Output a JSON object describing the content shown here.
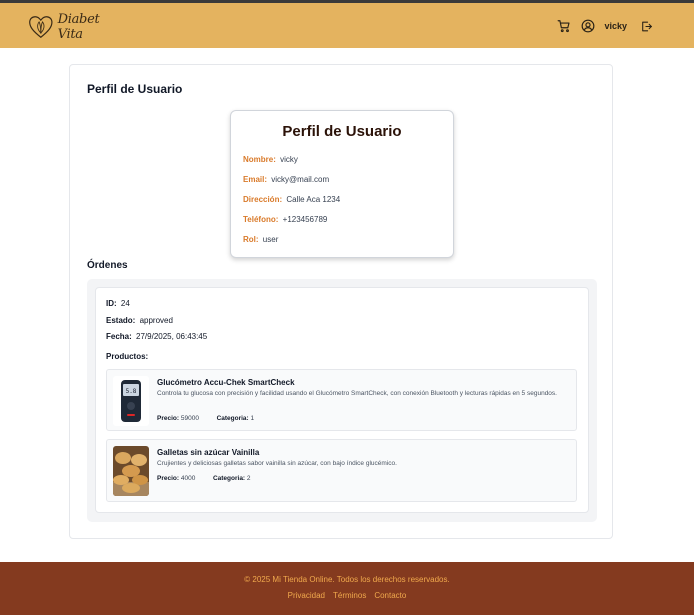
{
  "brand": {
    "logo_text": "Diabet Vita"
  },
  "header": {
    "username": "vicky",
    "icons": [
      "cart-icon",
      "user-circle-icon",
      "logout-icon"
    ]
  },
  "page": {
    "title": "Perfil de Usuario"
  },
  "profile": {
    "heading": "Perfil de Usuario",
    "fields": [
      {
        "label": "Nombre:",
        "value": "vicky"
      },
      {
        "label": "Email:",
        "value": "vicky@mail.com"
      },
      {
        "label": "Dirección:",
        "value": "Calle Aca 1234"
      },
      {
        "label": "Teléfono:",
        "value": "+123456789"
      },
      {
        "label": "Rol:",
        "value": "user"
      }
    ]
  },
  "orders": {
    "title": "Órdenes",
    "items": [
      {
        "id_label": "ID:",
        "id": "24",
        "status_label": "Estado:",
        "status": "approved",
        "date_label": "Fecha:",
        "date": "27/9/2025, 06:43:45",
        "products_label": "Productos:",
        "products": [
          {
            "name": "Glucómetro Accu-Chek SmartCheck",
            "description": "Controla tu glucosa con precisión y facilidad usando el Glucómetro SmartCheck, con conexión Bluetooth y lecturas rápidas en 5 segundos.",
            "price_label": "Precio:",
            "price": "59000",
            "category_label": "Categoria:",
            "category": "1",
            "image": "glucometer-image"
          },
          {
            "name": "Galletas sin azúcar Vainilla",
            "description": "Crujientes y deliciosas galletas sabor vainilla sin azúcar, con bajo índice glucémico.",
            "price_label": "Precio:",
            "price": "4000",
            "category_label": "Categoria:",
            "category": "2",
            "image": "cookies-image"
          }
        ]
      }
    ]
  },
  "footer": {
    "copyright": "© 2025 Mi Tienda Online. Todos los derechos reservados.",
    "links": [
      "Privacidad",
      "Términos",
      "Contacto"
    ]
  },
  "colors": {
    "header_bg": "#e4b35f",
    "footer_bg": "#843a1f",
    "label_accent": "#d97a2a",
    "footer_text": "#f0a94d"
  }
}
